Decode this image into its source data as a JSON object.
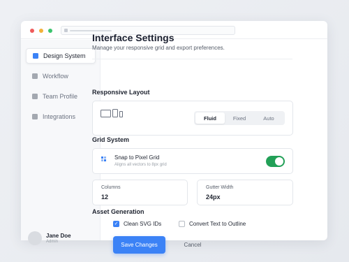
{
  "sidebar": {
    "items": [
      {
        "label": "Design System",
        "active": true
      },
      {
        "label": "Workflow",
        "active": false
      },
      {
        "label": "Team Profile",
        "active": false
      },
      {
        "label": "Integrations",
        "active": false
      }
    ],
    "profile": {
      "name": "Jane Doe",
      "role": "Admin"
    }
  },
  "main": {
    "title": "Interface Settings",
    "subtitle": "Manage your responsive grid and export preferences."
  },
  "responsive": {
    "section_title": "Responsive Layout",
    "options": [
      "Fluid",
      "Fixed",
      "Auto"
    ],
    "selected": "Fluid"
  },
  "grid": {
    "section_title": "Grid System",
    "snap_title": "Snap to Pixel Grid",
    "snap_desc": "Aligns all vectors to 8px grid",
    "snap_enabled": true,
    "columns_label": "Columns",
    "columns_value": "12",
    "gutter_label": "Gutter Width",
    "gutter_value": "24px"
  },
  "assets": {
    "section_title": "Asset Generation",
    "clean_svg_label": "Clean SVG IDs",
    "clean_svg_checked": true,
    "convert_text_label": "Convert Text to Outline",
    "convert_text_checked": false
  },
  "actions": {
    "save_label": "Save Changes",
    "cancel_label": "Cancel"
  },
  "colors": {
    "accent": "#3b82f6",
    "toggle_on": "#22a057"
  }
}
